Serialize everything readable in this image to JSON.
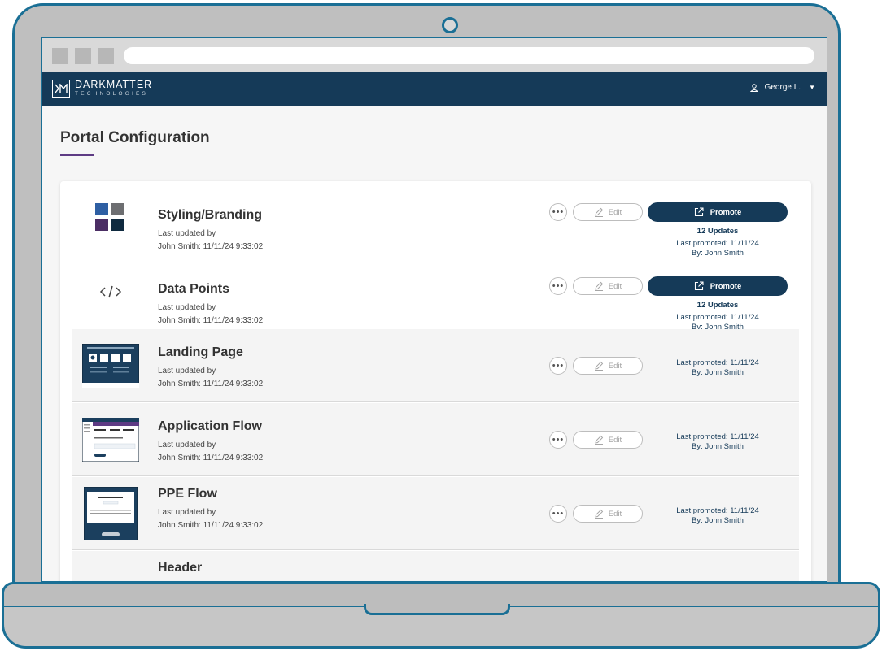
{
  "header": {
    "brand_name": "DARKMATTER",
    "brand_sub": "TECHNOLOGIES",
    "user_name": "George L."
  },
  "page": {
    "title": "Portal Configuration"
  },
  "rows": [
    {
      "name": "Styling/Branding",
      "meta_label": "Last updated by",
      "meta_value": "John Smith: 11/11/24  9:33:02",
      "more": "•••",
      "edit": "Edit",
      "promote": "Promote",
      "updates": "12 Updates",
      "last_promoted": "Last promoted: 11/11/24",
      "by": "By: John Smith"
    },
    {
      "name": "Data Points",
      "meta_label": "Last updated by",
      "meta_value": "John Smith: 11/11/24  9:33:02",
      "more": "•••",
      "edit": "Edit",
      "promote": "Promote",
      "updates": "12 Updates",
      "last_promoted": "Last promoted: 11/11/24",
      "by": "By: John Smith"
    },
    {
      "name": "Landing Page",
      "meta_label": "Last updated by",
      "meta_value": "John Smith: 11/11/24  9:33:02",
      "more": "•••",
      "edit": "Edit",
      "last_promoted": "Last promoted: 11/11/24",
      "by": "By: John Smith"
    },
    {
      "name": "Application Flow",
      "meta_label": "Last updated by",
      "meta_value": "John Smith: 11/11/24  9:33:02",
      "more": "•••",
      "edit": "Edit",
      "last_promoted": "Last promoted: 11/11/24",
      "by": "By: John Smith"
    },
    {
      "name": "PPE Flow",
      "meta_label": "Last updated by",
      "meta_value": "John Smith: 11/11/24  9:33:02",
      "more": "•••",
      "edit": "Edit",
      "last_promoted": "Last promoted: 11/11/24",
      "by": "By: John Smith"
    },
    {
      "name": "Header"
    }
  ],
  "colors": {
    "navy": "#153a58",
    "accent_purple": "#5e3b84",
    "frame_blue": "#1a6f95",
    "swatch_blue": "#2e5fa3",
    "swatch_gray": "#6d6e71",
    "swatch_purple": "#4b2e64",
    "swatch_navy": "#0f2a3f"
  },
  "icons": {
    "user": "user-icon",
    "dropdown": "chevron-down-icon",
    "edit": "pencil-icon",
    "promote": "external-link-icon",
    "code": "code-icon"
  }
}
